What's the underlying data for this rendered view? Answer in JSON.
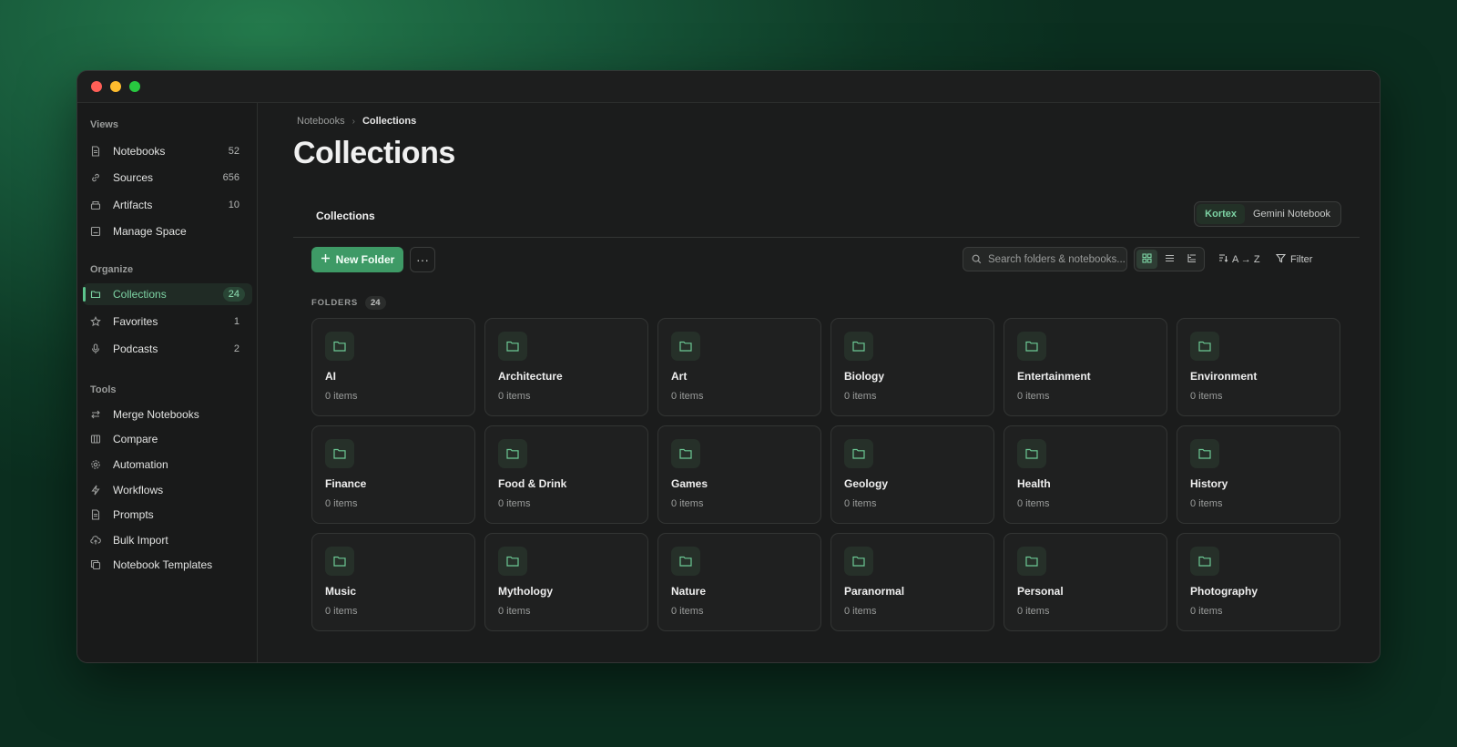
{
  "window": {
    "controls": [
      "close",
      "minimize",
      "zoom"
    ]
  },
  "sidebar": {
    "views_title": "Views",
    "views": [
      {
        "label": "Notebooks",
        "count": "52",
        "icon": "document-icon"
      },
      {
        "label": "Sources",
        "count": "656",
        "icon": "link-icon"
      },
      {
        "label": "Artifacts",
        "count": "10",
        "icon": "box-icon"
      },
      {
        "label": "Manage Space",
        "count": "",
        "icon": "storage-icon"
      }
    ],
    "organize_title": "Organize",
    "organize": [
      {
        "label": "Collections",
        "count": "24",
        "icon": "folder-icon",
        "active": true
      },
      {
        "label": "Favorites",
        "count": "1",
        "icon": "star-icon"
      },
      {
        "label": "Podcasts",
        "count": "2",
        "icon": "microphone-icon"
      }
    ],
    "tools_title": "Tools",
    "tools": [
      {
        "label": "Merge Notebooks",
        "icon": "merge-arrows-icon"
      },
      {
        "label": "Compare",
        "icon": "columns-icon"
      },
      {
        "label": "Automation",
        "icon": "gear-icon"
      },
      {
        "label": "Workflows",
        "icon": "lightning-icon"
      },
      {
        "label": "Prompts",
        "icon": "document-icon"
      },
      {
        "label": "Bulk Import",
        "icon": "cloud-upload-icon"
      },
      {
        "label": "Notebook Templates",
        "icon": "copy-icon"
      }
    ]
  },
  "main": {
    "breadcrumb": {
      "parent": "Notebooks",
      "separator": "›",
      "current": "Collections"
    },
    "title": "Collections",
    "tab_label": "Collections",
    "source_toggle": {
      "options": [
        "Kortex",
        "Gemini Notebook"
      ],
      "selected": "Kortex"
    },
    "toolbar": {
      "new_folder_label": "New Folder",
      "more_label": "···",
      "search_placeholder": "Search folders & notebooks...",
      "view_modes": [
        "grid",
        "list",
        "tree"
      ],
      "view_selected": "grid",
      "sort_label": "A → Z",
      "filter_label": "Filter"
    },
    "folders_label": "FOLDERS",
    "folders_count": "24",
    "folders": [
      {
        "name": "AI",
        "items": "0 items"
      },
      {
        "name": "Architecture",
        "items": "0 items"
      },
      {
        "name": "Art",
        "items": "0 items"
      },
      {
        "name": "Biology",
        "items": "0 items"
      },
      {
        "name": "Entertainment",
        "items": "0 items"
      },
      {
        "name": "Environment",
        "items": "0 items"
      },
      {
        "name": "Finance",
        "items": "0 items"
      },
      {
        "name": "Food & Drink",
        "items": "0 items"
      },
      {
        "name": "Games",
        "items": "0 items"
      },
      {
        "name": "Geology",
        "items": "0 items"
      },
      {
        "name": "Health",
        "items": "0 items"
      },
      {
        "name": "History",
        "items": "0 items"
      },
      {
        "name": "Music",
        "items": "0 items"
      },
      {
        "name": "Mythology",
        "items": "0 items"
      },
      {
        "name": "Nature",
        "items": "0 items"
      },
      {
        "name": "Paranormal",
        "items": "0 items"
      },
      {
        "name": "Personal",
        "items": "0 items"
      },
      {
        "name": "Photography",
        "items": "0 items"
      }
    ]
  },
  "colors": {
    "accent": "#3e9a66",
    "accent_text": "#7dd3a4",
    "background": "#1b1c1c"
  }
}
